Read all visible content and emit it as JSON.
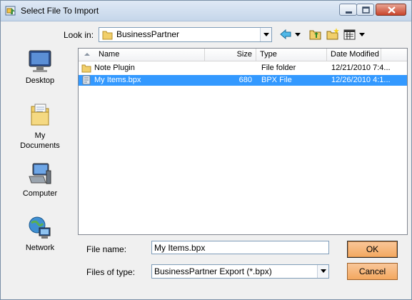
{
  "window": {
    "title": "Select File To Import"
  },
  "look_in": {
    "label": "Look in:",
    "value": "BusinessPartner"
  },
  "places": [
    {
      "label": "Desktop",
      "icon": "desktop-icon"
    },
    {
      "label": "My\nDocuments",
      "icon": "my-documents-icon"
    },
    {
      "label": "Computer",
      "icon": "computer-icon"
    },
    {
      "label": "Network",
      "icon": "network-icon"
    }
  ],
  "list": {
    "columns": {
      "name": "Name",
      "size": "Size",
      "type": "Type",
      "modified": "Date Modified"
    },
    "rows": [
      {
        "name": "Note Plugin",
        "size": "",
        "type": "File folder",
        "modified": "12/21/2010 7:4...",
        "icon": "folder-icon",
        "selected": false
      },
      {
        "name": "My Items.bpx",
        "size": "680",
        "type": "BPX File",
        "modified": "12/26/2010 4:1...",
        "icon": "file-icon",
        "selected": true
      }
    ]
  },
  "file_name": {
    "label": "File name:",
    "value": "My Items.bpx"
  },
  "file_type": {
    "label": "Files of type:",
    "value": "BusinessPartner Export (*.bpx)"
  },
  "buttons": {
    "ok": "OK",
    "cancel": "Cancel"
  },
  "colors": {
    "selection": "#3399ff",
    "button": "#f3a85f"
  }
}
